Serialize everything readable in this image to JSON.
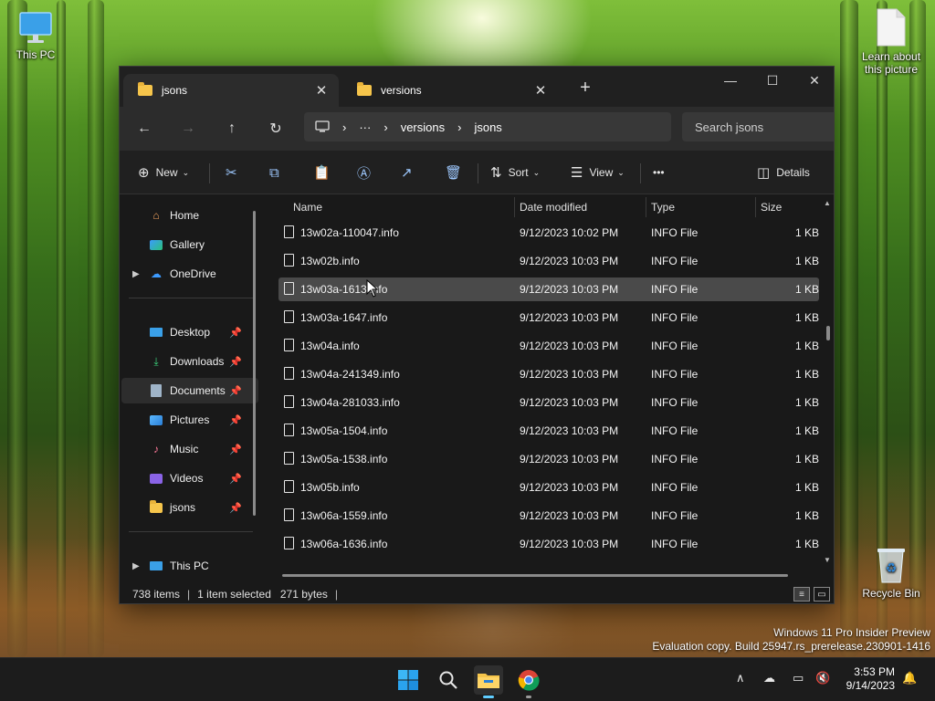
{
  "desktop": {
    "icons": {
      "this_pc": "This PC",
      "learn": "Learn about this picture",
      "recycle_bin": "Recycle Bin"
    },
    "watermark": {
      "line1": "Windows 11 Pro Insider Preview",
      "line2": "Evaluation copy. Build 25947.rs_prerelease.230901-1416"
    }
  },
  "explorer": {
    "tabs": [
      {
        "label": "jsons",
        "active": true,
        "close": "✕"
      },
      {
        "label": "versions",
        "active": false,
        "close": "✕"
      }
    ],
    "new_tab": "+",
    "window_controls": {
      "minimize": "—",
      "maximize": "☐",
      "close": "✕"
    },
    "nav": {
      "back": "←",
      "forward": "→",
      "up": "↑",
      "refresh": "↻"
    },
    "address": {
      "pc_icon": "monitor-icon",
      "chevron": "›",
      "ellipsis": "···",
      "crumbs": [
        "versions",
        "jsons"
      ]
    },
    "search_placeholder": "Search jsons",
    "commands": {
      "new": "New",
      "sort": "Sort",
      "view": "View",
      "more": "•••",
      "details": "Details"
    },
    "sidebar": {
      "items": [
        {
          "label": "Home",
          "icon": "home-icon"
        },
        {
          "label": "Gallery",
          "icon": "gallery-icon"
        },
        {
          "label": "OneDrive",
          "icon": "cloud-icon"
        },
        {
          "label": "Desktop",
          "icon": "desktop-icon"
        },
        {
          "label": "Downloads",
          "icon": "download-icon"
        },
        {
          "label": "Documents",
          "icon": "documents-icon"
        },
        {
          "label": "Pictures",
          "icon": "pictures-icon"
        },
        {
          "label": "Music",
          "icon": "music-icon"
        },
        {
          "label": "Videos",
          "icon": "videos-icon"
        },
        {
          "label": "jsons",
          "icon": "folder-icon"
        },
        {
          "label": "This PC",
          "icon": "pc-icon"
        }
      ]
    },
    "columns": {
      "name": "Name",
      "date": "Date modified",
      "type": "Type",
      "size": "Size"
    },
    "files": [
      {
        "name": "13w02a-110047.info",
        "date": "9/12/2023 10:02 PM",
        "type": "INFO File",
        "size": "1 KB"
      },
      {
        "name": "13w02b.info",
        "date": "9/12/2023 10:03 PM",
        "type": "INFO File",
        "size": "1 KB"
      },
      {
        "name": "13w03a-1613.info",
        "date": "9/12/2023 10:03 PM",
        "type": "INFO File",
        "size": "1 KB"
      },
      {
        "name": "13w03a-1647.info",
        "date": "9/12/2023 10:03 PM",
        "type": "INFO File",
        "size": "1 KB"
      },
      {
        "name": "13w04a.info",
        "date": "9/12/2023 10:03 PM",
        "type": "INFO File",
        "size": "1 KB"
      },
      {
        "name": "13w04a-241349.info",
        "date": "9/12/2023 10:03 PM",
        "type": "INFO File",
        "size": "1 KB"
      },
      {
        "name": "13w04a-281033.info",
        "date": "9/12/2023 10:03 PM",
        "type": "INFO File",
        "size": "1 KB"
      },
      {
        "name": "13w05a-1504.info",
        "date": "9/12/2023 10:03 PM",
        "type": "INFO File",
        "size": "1 KB"
      },
      {
        "name": "13w05a-1538.info",
        "date": "9/12/2023 10:03 PM",
        "type": "INFO File",
        "size": "1 KB"
      },
      {
        "name": "13w05b.info",
        "date": "9/12/2023 10:03 PM",
        "type": "INFO File",
        "size": "1 KB"
      },
      {
        "name": "13w06a-1559.info",
        "date": "9/12/2023 10:03 PM",
        "type": "INFO File",
        "size": "1 KB"
      },
      {
        "name": "13w06a-1636.info",
        "date": "9/12/2023 10:03 PM",
        "type": "INFO File",
        "size": "1 KB"
      }
    ],
    "status": {
      "item_count": "738 items",
      "selection": "1 item selected",
      "selection_size": "271 bytes"
    }
  },
  "taskbar": {
    "clock_time": "3:53 PM",
    "clock_date": "9/14/2023",
    "tray_chevron": "∧"
  }
}
